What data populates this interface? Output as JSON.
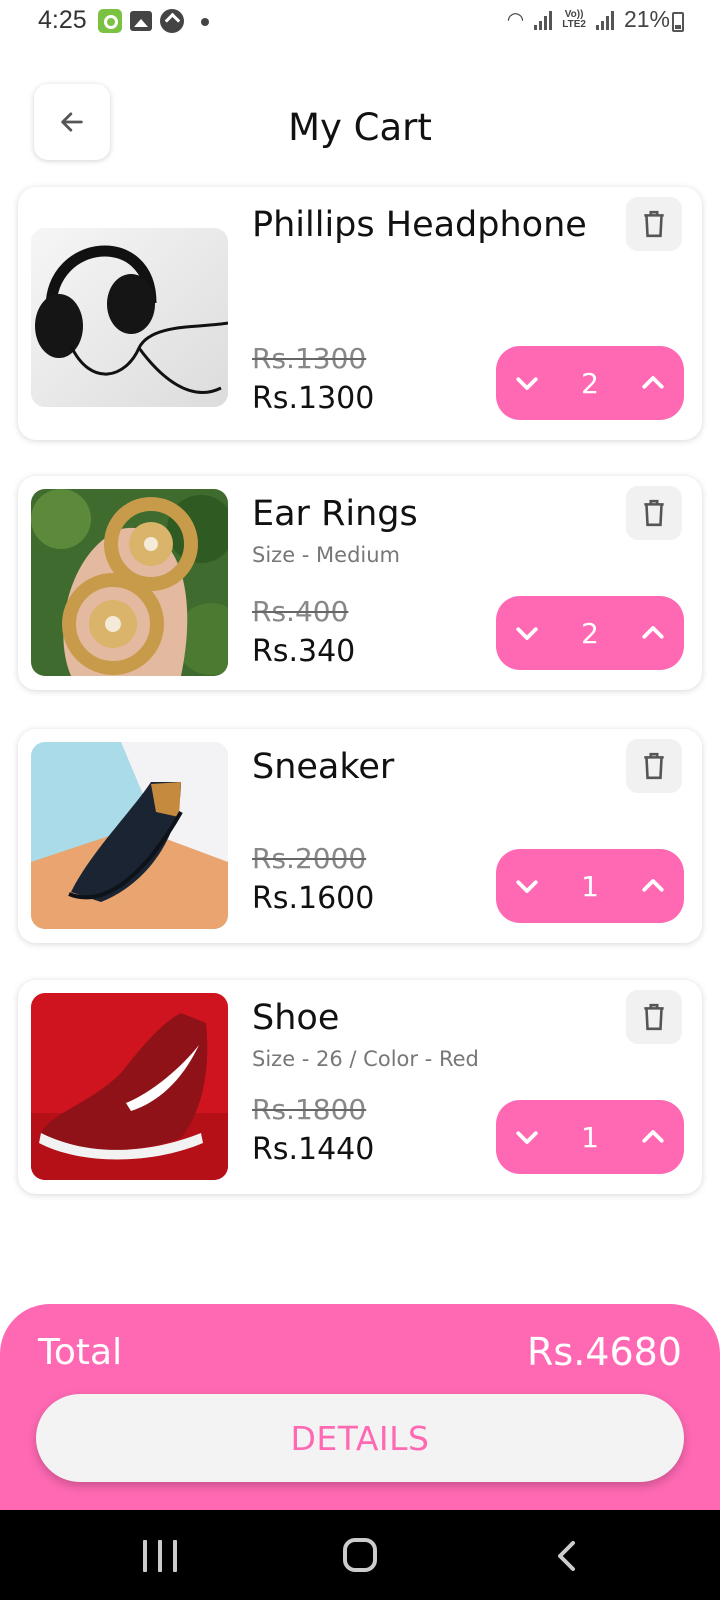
{
  "status_bar": {
    "time": "4:25",
    "battery": "21%",
    "network": "LTE2",
    "volte": "Vo))"
  },
  "header": {
    "title": "My Cart",
    "back_icon": "arrow-left-icon"
  },
  "cart": {
    "items": [
      {
        "name": "Phillips Headphone",
        "variant": "",
        "old_price": "Rs.1300",
        "price": "Rs.1300",
        "quantity": "2"
      },
      {
        "name": "Ear Rings",
        "variant": "Size - Medium",
        "old_price": "Rs.400",
        "price": "Rs.340",
        "quantity": "2"
      },
      {
        "name": "Sneaker",
        "variant": "",
        "old_price": "Rs.2000",
        "price": "Rs.1600",
        "quantity": "1"
      },
      {
        "name": "Shoe",
        "variant": "Size - 26 / Color - Red",
        "old_price": "Rs.1800",
        "price": "Rs.1440",
        "quantity": "1"
      }
    ]
  },
  "footer": {
    "total_label": "Total",
    "total_value": "Rs.4680",
    "details_label": "DETAILS"
  },
  "colors": {
    "accent": "#ff69b4",
    "button_bg": "#f3f3f3",
    "trash_bg": "#f1f1f1"
  }
}
